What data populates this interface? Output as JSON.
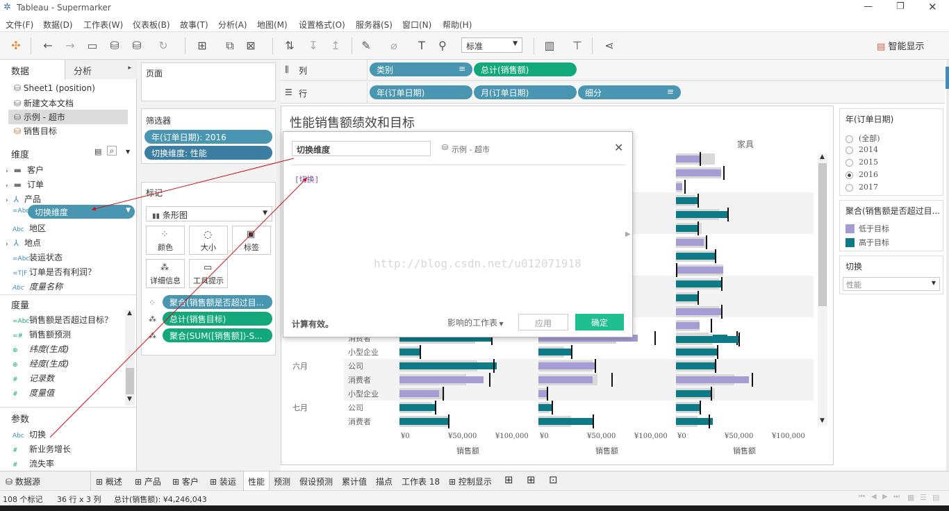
{
  "window": {
    "title": "Tableau - Supermarker"
  },
  "menu": [
    "文件(F)",
    "数据(D)",
    "工作表(W)",
    "仪表板(B)",
    "故事(T)",
    "分析(A)",
    "地图(M)",
    "设置格式(O)",
    "服务器(S)",
    "窗口(N)",
    "帮助(H)"
  ],
  "toolbar": {
    "fit_value": "标准",
    "show_me": "智能显示"
  },
  "left": {
    "tab_data": "数据",
    "tab_analysis": "分析",
    "datasources": [
      "Sheet1 (position)",
      "新建文本文档",
      "示例 - 超市",
      "销售目标"
    ],
    "dimensions_header": "维度",
    "dimensions": [
      "客户",
      "订单",
      "产品",
      "切换维度",
      "地区",
      "地点",
      "装运状态",
      "订单是否有利润？",
      "度量名称"
    ],
    "measures_header": "度量",
    "measures": [
      "销售额是否超过目标？",
      "销售额预测",
      "纬度(生成)",
      "经度(生成)",
      "记录数",
      "度量值"
    ],
    "params_header": "参数",
    "params": [
      "切换",
      "新业务增长",
      "流失率"
    ]
  },
  "mid": {
    "pages": "页面",
    "filters": "筛选器",
    "filter_pills": [
      "年(订单日期): 2016",
      "切换维度: 性能"
    ],
    "marks": "标记",
    "mark_type": "条形图",
    "mark_btns": [
      "颜色",
      "大小",
      "标签",
      "详细信息",
      "工具提示"
    ],
    "mark_pills": [
      "聚合(销售额是否超过目...",
      "总计(销售目标)",
      "聚合(SUM([销售额])-S..."
    ]
  },
  "shelves": {
    "cols_label": "列",
    "rows_label": "行",
    "cols": [
      "类别",
      "总计(销售额)"
    ],
    "rows": [
      "年(订单日期)",
      "月(订单日期)",
      "细分"
    ]
  },
  "view": {
    "title": "性能销售额绩效和目标",
    "col_header": "家具",
    "rows": [
      {
        "month": "",
        "seg": "消费者"
      },
      {
        "month": "",
        "seg": "小型企业"
      },
      {
        "month": "六月",
        "seg": "公司"
      },
      {
        "month": "",
        "seg": "消费者"
      },
      {
        "month": "",
        "seg": "小型企业"
      },
      {
        "month": "七月",
        "seg": "公司"
      },
      {
        "month": "",
        "seg": "消费者"
      }
    ],
    "axis_ticks": [
      "¥0",
      "¥50,000",
      "¥100,000"
    ],
    "axis_title": "销售额",
    "watermark": "http://blog.csdn.net/u012071918"
  },
  "dialog": {
    "name": "切换维度",
    "datasource": "示例 - 超市",
    "formula": "[切换]",
    "status": "计算有效。",
    "dependents": "影响的工作表",
    "apply": "应用",
    "ok": "确定"
  },
  "right": {
    "year_title": "年(订单日期)",
    "year_options": [
      "(全部)",
      "2014",
      "2015",
      "2016",
      "2017"
    ],
    "year_selected": "2016",
    "legend_title": "聚合(销售额是否超过目...",
    "legend_items": [
      "低于目标",
      "高于目标"
    ],
    "legend_colors": [
      "#a59cd3",
      "#0e7a86"
    ],
    "param_title": "切换",
    "param_value": "性能"
  },
  "bottom_tabs": [
    "数据源",
    "概述",
    "产品",
    "客户",
    "装运",
    "性能",
    "预测",
    "假设预测",
    "累计值",
    "描点",
    "工作表 18",
    "控制显示"
  ],
  "status": {
    "marks": "108 个标记",
    "dims": "36 行 x 3 列",
    "sum": "总计(销售额): ¥4,246,043"
  }
}
